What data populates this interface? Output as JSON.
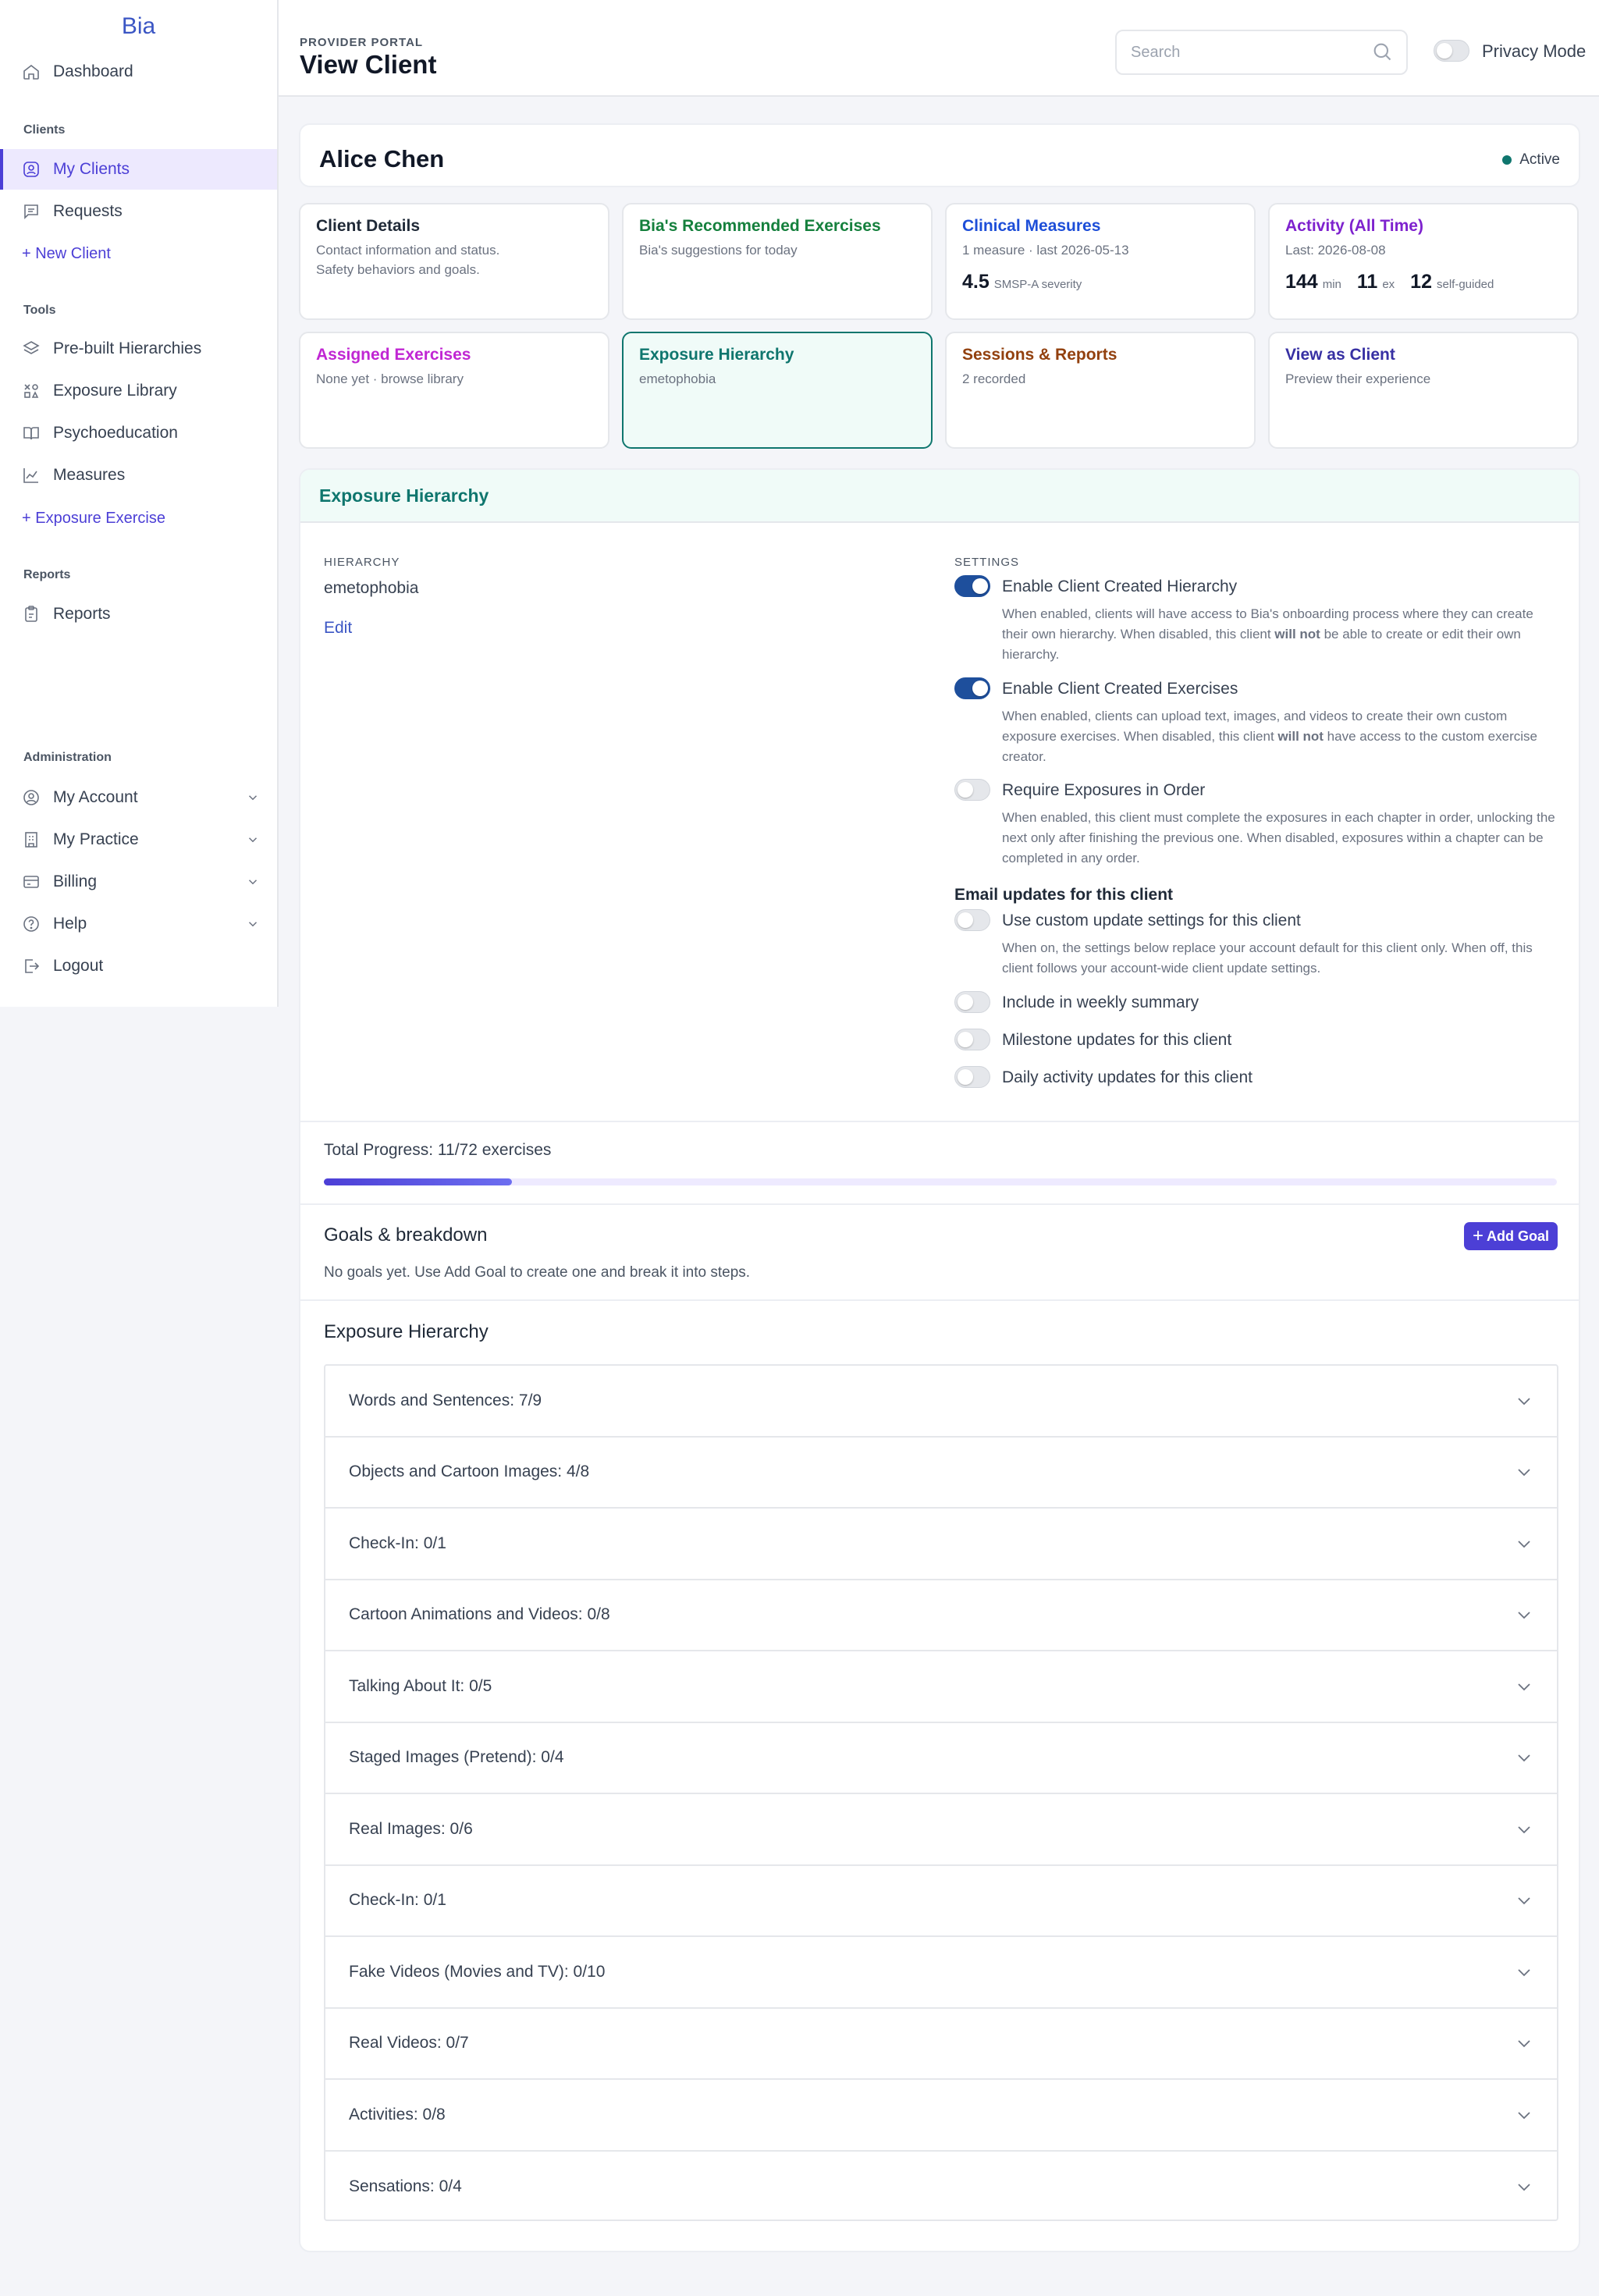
{
  "sidebar": {
    "brand": "Bia",
    "dashboard": "Dashboard",
    "clients_label": "Clients",
    "my_clients": "My Clients",
    "requests": "Requests",
    "new_client": "+ New Client",
    "tools_label": "Tools",
    "prebuilt": "Pre-built Hierarchies",
    "exposure_library": "Exposure Library",
    "psychoeducation": "Psychoeducation",
    "measures": "Measures",
    "exposure_exercise": "+ Exposure Exercise",
    "reports_label": "Reports",
    "reports": "Reports",
    "admin_label": "Administration",
    "my_account": "My Account",
    "my_practice": "My Practice",
    "billing": "Billing",
    "help": "Help",
    "logout": "Logout"
  },
  "header": {
    "eyebrow": "PROVIDER PORTAL",
    "title": "View Client",
    "search_placeholder": "Search",
    "privacy_label": "Privacy Mode",
    "privacy_on": false
  },
  "client": {
    "name": "Alice Chen",
    "status": "Active"
  },
  "tiles": [
    {
      "title": "Client Details",
      "color": "#1f2937",
      "sub": "Contact information and status.",
      "sub2": "Safety behaviors and goals."
    },
    {
      "title": "Bia's Recommended Exercises",
      "color": "#15803d",
      "sub": "Bia's suggestions for today"
    },
    {
      "title": "Clinical Measures",
      "color": "#1d4ed8",
      "sub": "1 measure · last 2026-05-13",
      "stat_num": "4.5",
      "stat_unit": "SMSP-A severity"
    },
    {
      "title": "Activity (All Time)",
      "color": "#7e22ce",
      "sub": "Last: 2026-08-08",
      "stats": [
        {
          "num": "144",
          "unit": "min"
        },
        {
          "num": "11",
          "unit": "ex"
        },
        {
          "num": "12",
          "unit": "self-guided"
        }
      ]
    },
    {
      "title": "Assigned Exercises",
      "color": "#c026d3",
      "sub": "None yet · browse library"
    },
    {
      "title": "Exposure Hierarchy",
      "color": "#0f766e",
      "sub": "emetophobia"
    },
    {
      "title": "Sessions & Reports",
      "color": "#92400e",
      "sub": "2 recorded"
    },
    {
      "title": "View as Client",
      "color": "#3730a3",
      "sub": "Preview their experience"
    }
  ],
  "hierarchy_section": {
    "title": "Exposure Hierarchy",
    "hierarchy_label": "HIERARCHY",
    "hierarchy_value": "emetophobia",
    "edit": "Edit",
    "settings_label": "SETTINGS",
    "settings": [
      {
        "title": "Enable Client Created Hierarchy",
        "on": true,
        "desc_before": "When enabled, clients will have access to Bia's onboarding process where they can create their own hierarchy. When disabled, this client ",
        "desc_bold": "will not",
        "desc_after": " be able to create or edit their own hierarchy."
      },
      {
        "title": "Enable Client Created Exercises",
        "on": true,
        "desc_before": "When enabled, clients can upload text, images, and videos to create their own custom exposure exercises. When disabled, this client ",
        "desc_bold": "will not",
        "desc_after": " have access to the custom exercise creator."
      },
      {
        "title": "Require Exposures in Order",
        "on": false,
        "desc_before": "When enabled, this client must complete the exposures in each chapter in order, unlocking the next only after finishing the previous one. When disabled, exposures within a chapter can be completed in any order."
      }
    ],
    "email_head": "Email updates for this client",
    "email_settings": [
      {
        "title": "Use custom update settings for this client",
        "on": false,
        "desc": "When on, the settings below replace your account default for this client only. When off, this client follows your account-wide client update settings."
      },
      {
        "title": "Include in weekly summary",
        "on": false
      },
      {
        "title": "Milestone updates for this client",
        "on": false
      },
      {
        "title": "Daily activity updates for this client",
        "on": false
      }
    ],
    "progress_text": "Total Progress: 11/72 exercises",
    "progress_fraction": 0.1528,
    "goals_title": "Goals & breakdown",
    "add_goal": "Add Goal",
    "goals_empty": "No goals yet. Use Add Goal to create one and break it into steps.",
    "hierarchy_list_title": "Exposure Hierarchy",
    "chapters": [
      "Words and Sentences: 7/9",
      "Objects and Cartoon Images: 4/8",
      "Check-In: 0/1",
      "Cartoon Animations and Videos: 0/8",
      "Talking About It: 0/5",
      "Staged Images (Pretend): 0/4",
      "Real Images: 0/6",
      "Check-In: 0/1",
      "Fake Videos (Movies and TV): 0/10",
      "Real Videos: 0/7",
      "Activities: 0/8",
      "Sensations: 0/4"
    ]
  }
}
